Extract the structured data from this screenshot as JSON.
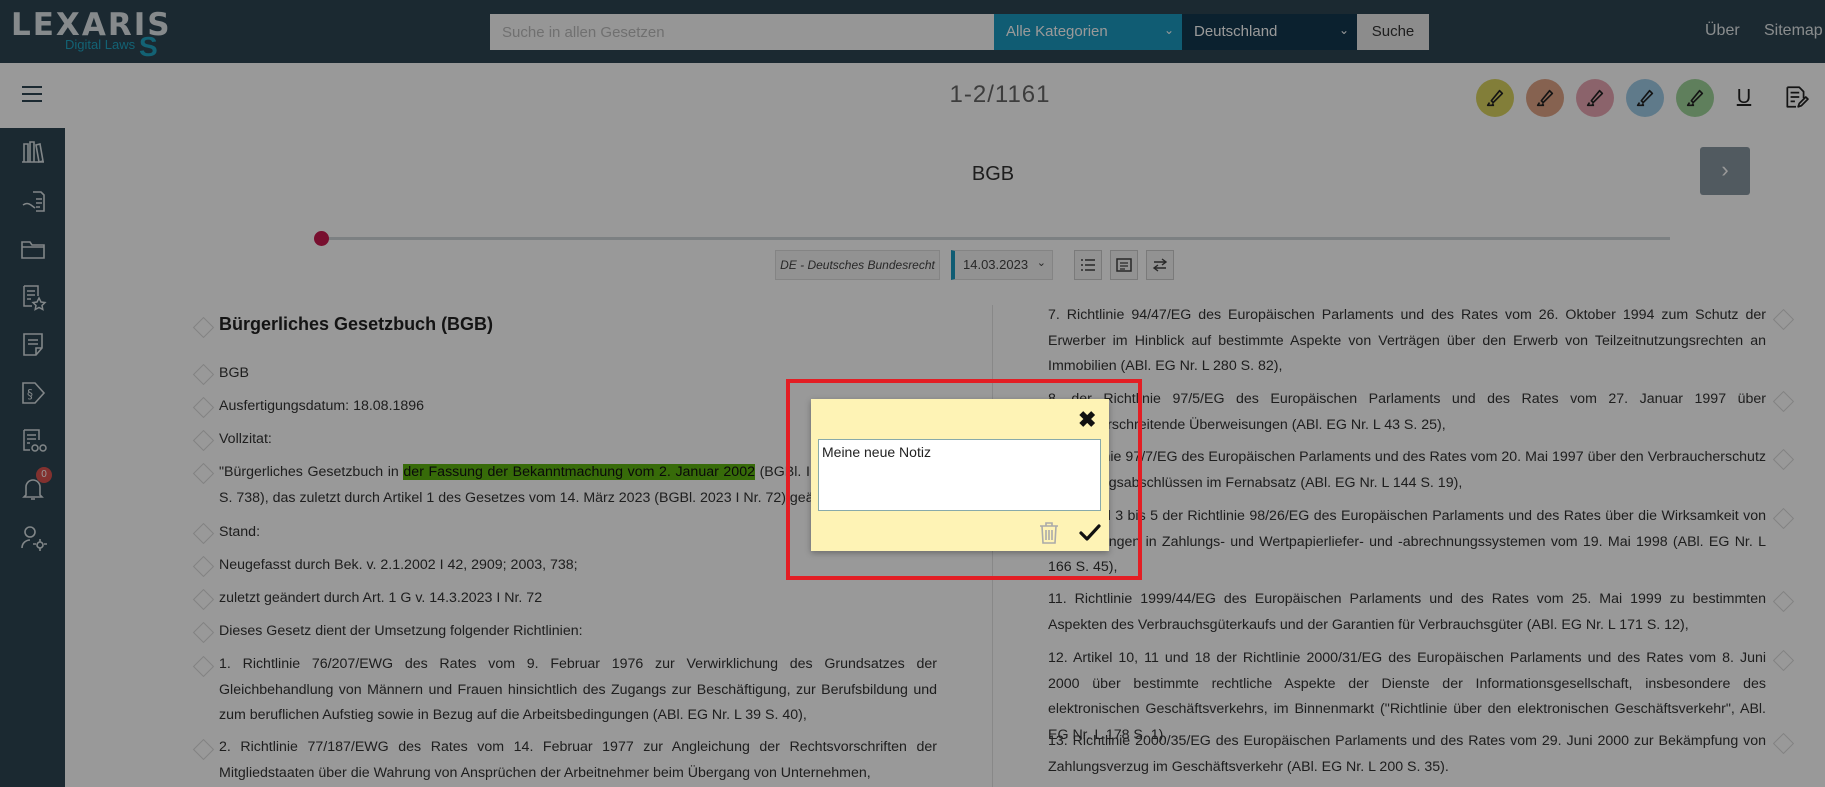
{
  "header": {
    "logo_main": "LEXARIS",
    "logo_sub": "Digital Laws",
    "search_placeholder": "Suche in allen Gesetzen",
    "category_select": "Alle Kategorien",
    "country_select": "Deutschland",
    "search_button": "Suche",
    "nav_about": "Über",
    "nav_sitemap": "Sitemap"
  },
  "toolbar": {
    "page_count": "1-2/1161",
    "highlighters": [
      {
        "name": "highlighter-yellow",
        "color": "#d9d25f"
      },
      {
        "name": "highlighter-orange",
        "color": "#e0a386"
      },
      {
        "name": "highlighter-pink",
        "color": "#e8a6b3"
      },
      {
        "name": "highlighter-blue",
        "color": "#9ecbe6"
      },
      {
        "name": "highlighter-green",
        "color": "#9fd49a"
      }
    ],
    "underline_symbol": "U"
  },
  "sidebar": {
    "icons": [
      "library-icon",
      "document-hand-icon",
      "folder-icon",
      "favorites-list-icon",
      "notes-icon",
      "paragraph-icon",
      "reading-list-icon",
      "bell-icon",
      "user-settings-icon"
    ],
    "notification_count": "0"
  },
  "document": {
    "title": "BGB",
    "dataset": "DE - Deutsches Bundesrecht",
    "date": "14.03.2023",
    "left": {
      "heading": "Bürgerliches Gesetzbuch (BGB)",
      "p1": "BGB",
      "p2": "Ausfertigungsdatum: 18.08.1896",
      "p3": "Vollzitat:",
      "p4_before": "\"Bürgerliches Gesetzbuch in ",
      "p4_mark": "der Fassung der Bekanntmachung vom 2. Januar 2002",
      "p4_after": " (BGBl. I S. 42, 2909; 2003 I S. 738), das zuletzt durch Artikel 1 des Gesetzes vom 14. März 2023 (BGBl. 2023 I Nr. 72) geändert worden ist\"",
      "p5": "Stand:",
      "p6": "Neugefasst durch Bek. v. 2.1.2002 I 42, 2909; 2003, 738;",
      "p7": "zuletzt geändert durch Art. 1 G v. 14.3.2023 I Nr. 72",
      "p8": "Dieses Gesetz dient der Umsetzung folgender Richtlinien:",
      "p9": "1. Richtlinie 76/207/EWG des Rates vom 9. Februar 1976 zur Verwirklichung des Grundsatzes der Gleichbehandlung von Männern und Frauen hinsichtlich des Zugangs zur Beschäftigung, zur Berufsbildung und zum beruflichen Aufstieg sowie in Bezug auf die Arbeitsbedingungen (ABl. EG Nr. L 39 S. 40),",
      "p10": "2. Richtlinie 77/187/EWG des Rates vom 14. Februar 1977 zur Angleichung der Rechtsvorschriften der Mitgliedstaaten über die Wahrung von Ansprüchen der Arbeitnehmer beim Übergang von Unternehmen,"
    },
    "right": {
      "p7": "7. Richtlinie 94/47/EG des Europäischen Parlaments und des Rates vom 26. Oktober 1994 zum Schutz der Erwerber im Hinblick auf bestimmte Aspekte von Verträgen über den Erwerb von Teilzeitnutzungsrechten an Immobilien (ABl. EG Nr. L 280 S. 82),",
      "p8": "8. der Richtlinie 97/5/EG des Europäischen Parlaments und des Rates vom 27. Januar 1997 über grenzüberschreitende Überweisungen (ABl. EG Nr. L 43 S. 25),",
      "p9": "9. Richtlinie 97/7/EG des Europäischen Parlaments und des Rates vom 20. Mai 1997 über den Verbraucherschutz bei Vertragsabschlüssen im Fernabsatz (ABl. EG Nr. L 144 S. 19),",
      "p10": "10. Artikel 3 bis 5 der Richtlinie 98/26/EG des Europäischen Parlaments und des Rates über die Wirksamkeit von Abrechnungen in Zahlungs- und Wertpapierliefer- und -abrechnungssystemen vom 19. Mai 1998 (ABl. EG Nr. L 166 S. 45),",
      "p11": "11. Richtlinie 1999/44/EG des Europäischen Parlaments und des Rates vom 25. Mai 1999 zu bestimmten Aspekten des Verbrauchsgüterkaufs und der Garantien für Verbrauchsgüter (ABl. EG Nr. L 171 S. 12),",
      "p12": "12. Artikel 10, 11 und 18 der Richtlinie 2000/31/EG des Europäischen Parlaments und des Rates vom 8. Juni 2000 über bestimmte rechtliche Aspekte der Dienste der Informationsgesellschaft, insbesondere des elektronischen Geschäftsverkehrs, im Binnenmarkt (\"Richtlinie über den elektronischen Geschäftsverkehr\", ABl. EG Nr. L 178 S. 1),",
      "p13": "13. Richtlinie 2000/35/EG des Europäischen Parlaments und des Rates vom 29. Juni 2000 zur Bekämpfung von Zahlungsverzug im Geschäftsverkehr (ABl. EG Nr. L 200 S. 35)."
    }
  },
  "note_popup": {
    "text": "Meine neue Notiz"
  }
}
